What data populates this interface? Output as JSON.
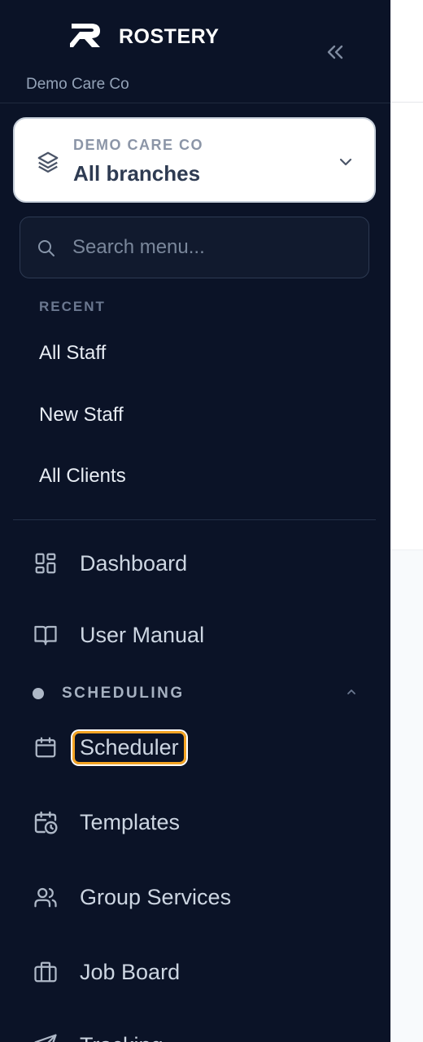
{
  "brand": {
    "name": "ROSTERY",
    "org_subtitle": "Demo Care Co"
  },
  "collapse": {
    "icon": "double-chevron-left-icon"
  },
  "branch_selector": {
    "kicker": "DEMO CARE CO",
    "value": "All branches",
    "icon": "layers-icon",
    "chevron": "chevron-down-icon"
  },
  "search": {
    "placeholder": "Search menu...",
    "value": "",
    "icon": "search-icon"
  },
  "recent": {
    "label": "RECENT",
    "items": [
      "All Staff",
      "New Staff",
      "All Clients"
    ]
  },
  "nav": {
    "dashboard": {
      "label": "Dashboard",
      "icon": "dashboard-grid-icon"
    },
    "user_manual": {
      "label": "User Manual",
      "icon": "book-open-icon"
    }
  },
  "scheduling": {
    "label": "SCHEDULING",
    "expanded": true,
    "items": [
      {
        "label": "Scheduler",
        "icon": "calendar-icon",
        "highlighted": true
      },
      {
        "label": "Templates",
        "icon": "calendar-clock-icon"
      },
      {
        "label": "Group Services",
        "icon": "users-icon"
      },
      {
        "label": "Job Board",
        "icon": "briefcase-icon"
      },
      {
        "label": "Tracking",
        "icon": "send-icon"
      }
    ]
  },
  "colors": {
    "sidebar_bg": "#0b1327",
    "highlight": "#f4a424",
    "text": "#cdd6e2"
  }
}
